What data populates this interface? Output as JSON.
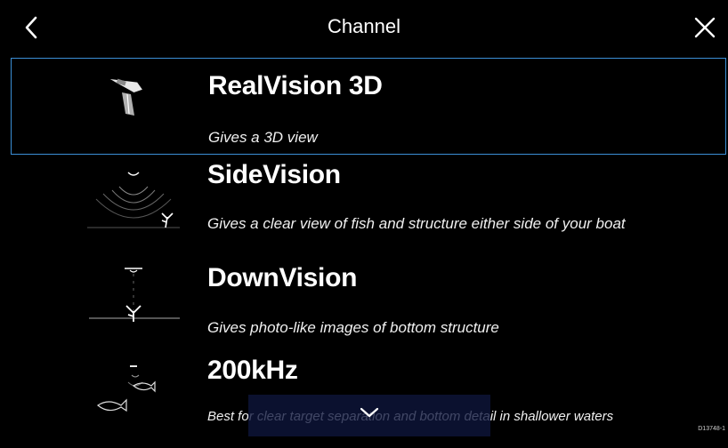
{
  "header": {
    "title": "Channel",
    "back_icon": "chevron-left-icon",
    "close_icon": "close-icon"
  },
  "channels": [
    {
      "name": "RealVision 3D",
      "description": "Gives a 3D view",
      "selected": true,
      "icon": "realvision-3d-icon"
    },
    {
      "name": "SideVision",
      "description": "Gives a clear view of fish and structure either side of your boat",
      "selected": false,
      "icon": "sidevision-icon"
    },
    {
      "name": "DownVision",
      "description": "Gives photo-like images of bottom structure",
      "selected": false,
      "icon": "downvision-icon"
    },
    {
      "name": "200kHz",
      "description": "Best for clear target separation and bottom detail in shallower waters",
      "selected": false,
      "icon": "200khz-icon"
    }
  ],
  "scroll_icon": "chevron-down-icon",
  "ref_code": "D13748-1",
  "colors": {
    "background": "#000000",
    "selection_border": "#3b8fd6",
    "scroll_overlay": "#0e163c"
  }
}
